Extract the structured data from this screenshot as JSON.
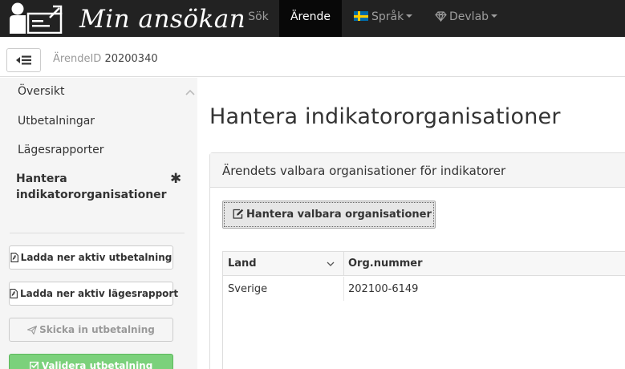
{
  "navbar": {
    "brand_title": "Min ansökan",
    "items": [
      {
        "label": "Sök",
        "active": false
      },
      {
        "label": "Ärende",
        "active": true
      },
      {
        "label": "Språk",
        "active": false
      },
      {
        "label": "Devlab",
        "active": false
      }
    ]
  },
  "subheader": {
    "case_label": "ÄrendeID",
    "case_id": "20200340"
  },
  "sidebar": {
    "links": [
      "Översikt",
      "Utbetalningar",
      "Lägesrapporter"
    ],
    "active_link_line1": "Hantera",
    "active_link_line2": "indikatororganisationer",
    "active_marker": "✱",
    "buttons": [
      "Ladda ner aktiv utbetalning",
      "Ladda ner aktiv lägesrapport",
      "Skicka in utbetalning",
      "Validera utbetalning"
    ]
  },
  "main": {
    "page_title": "Hantera indikatororganisationer",
    "panel_heading": "Ärendets valbara organisationer för indikatorer",
    "manage_button": "Hantera valbara organisationer",
    "table": {
      "columns": [
        "Land",
        "Org.nummer"
      ],
      "rows": [
        {
          "land": "Sverige",
          "org": "202100-6149"
        }
      ]
    }
  },
  "colors": {
    "navbar_bg": "#222222",
    "navbar_active_bg": "#080808",
    "success": "#7bd17b"
  }
}
